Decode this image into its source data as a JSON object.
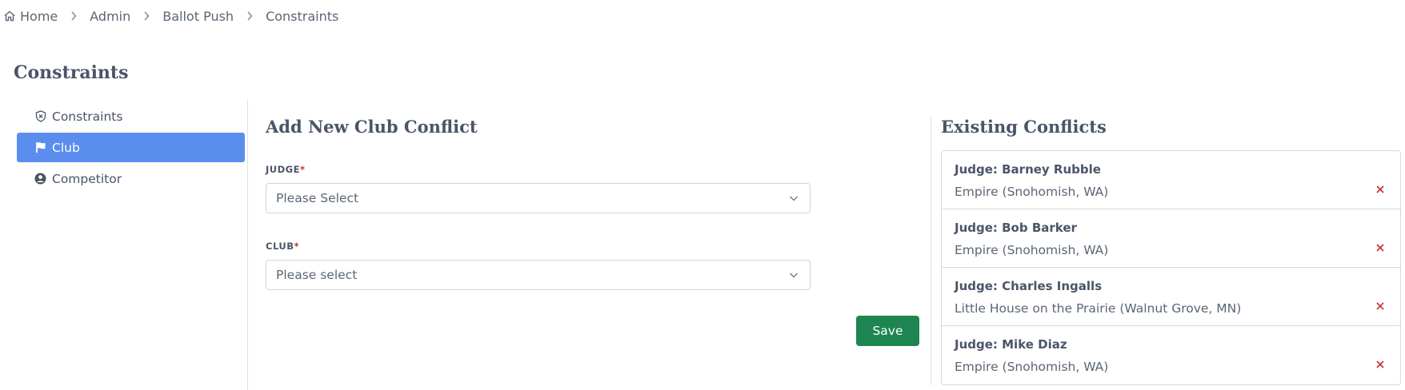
{
  "breadcrumb": {
    "items": [
      "Home",
      "Admin",
      "Ballot Push",
      "Constraints"
    ]
  },
  "page": {
    "title": "Constraints"
  },
  "sidebar": {
    "items": [
      {
        "label": "Constraints",
        "icon": "shield-x-icon",
        "active": false
      },
      {
        "label": "Club",
        "icon": "flag-icon",
        "active": true
      },
      {
        "label": "Competitor",
        "icon": "user-circle-icon",
        "active": false
      }
    ]
  },
  "form": {
    "title": "Add New Club Conflict",
    "judge_label": "JUDGE",
    "judge_placeholder": "Please Select",
    "club_label": "CLUB",
    "club_placeholder": "Please select",
    "required_mark": "*",
    "save_label": "Save"
  },
  "conflicts": {
    "title": "Existing Conflicts",
    "items": [
      {
        "judge": "Judge: Barney Rubble",
        "club": "Empire (Snohomish, WA)"
      },
      {
        "judge": "Judge: Bob Barker",
        "club": "Empire (Snohomish, WA)"
      },
      {
        "judge": "Judge: Charles Ingalls",
        "club": "Little House on the Prairie (Walnut Grove, MN)"
      },
      {
        "judge": "Judge: Mike Diaz",
        "club": "Empire (Snohomish, WA)"
      }
    ]
  },
  "colors": {
    "accent": "#5b8def",
    "save": "#1e8551",
    "delete": "#c53030",
    "text": "#4a5568"
  }
}
